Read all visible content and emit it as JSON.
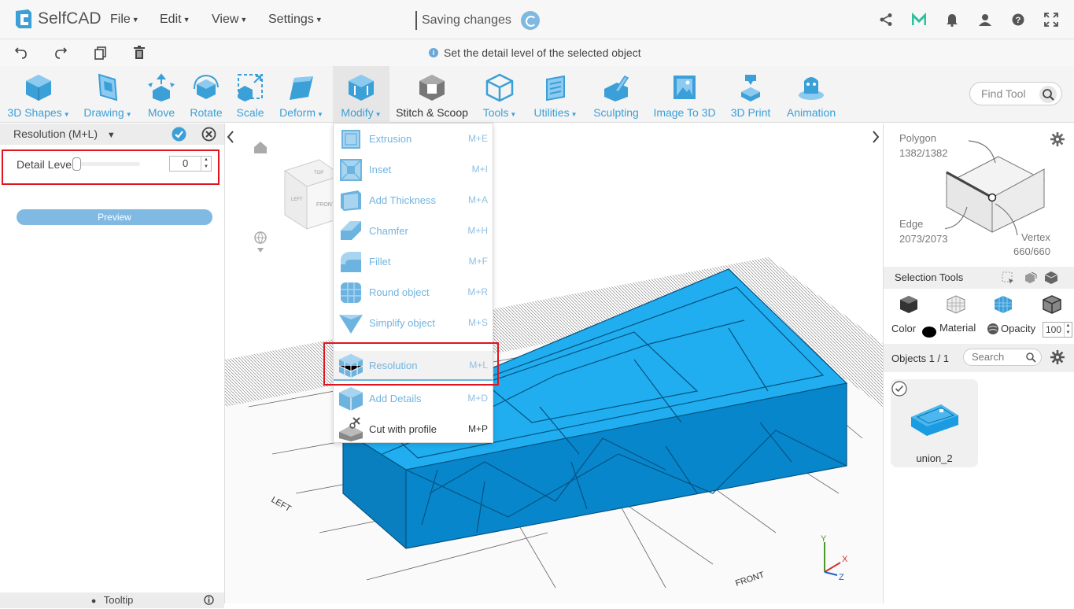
{
  "app": {
    "name": "SelfCAD"
  },
  "menus": [
    {
      "label": "File"
    },
    {
      "label": "Edit"
    },
    {
      "label": "View"
    },
    {
      "label": "Settings"
    }
  ],
  "status": {
    "saving": "Saving changes"
  },
  "hint": {
    "text": "Set the detail level of the selected object"
  },
  "toolbar": {
    "tools": [
      {
        "label": "3D Shapes"
      },
      {
        "label": "Drawing"
      },
      {
        "label": "Move"
      },
      {
        "label": "Rotate"
      },
      {
        "label": "Scale"
      },
      {
        "label": "Deform"
      },
      {
        "label": "Modify"
      },
      {
        "label": "Stitch & Scoop"
      },
      {
        "label": "Tools"
      },
      {
        "label": "Utilities"
      },
      {
        "label": "Sculpting"
      },
      {
        "label": "Image To 3D"
      },
      {
        "label": "3D Print"
      },
      {
        "label": "Animation"
      }
    ],
    "find_placeholder": "Find Tool"
  },
  "left_panel": {
    "title": "Resolution (M+L)",
    "detail_label": "Detail Level",
    "detail_value": "0",
    "detail_level_fraction": 0,
    "preview_label": "Preview",
    "tooltip_label": "Tooltip"
  },
  "modify_menu": {
    "items": [
      {
        "label": "Extrusion",
        "shortcut": "M+E"
      },
      {
        "label": "Inset",
        "shortcut": "M+I"
      },
      {
        "label": "Add Thickness",
        "shortcut": "M+A"
      },
      {
        "label": "Chamfer",
        "shortcut": "M+H"
      },
      {
        "label": "Fillet",
        "shortcut": "M+F"
      },
      {
        "label": "Round object",
        "shortcut": "M+R"
      },
      {
        "label": "Simplify object",
        "shortcut": "M+S"
      },
      {
        "label": "Resolution",
        "shortcut": "M+L"
      },
      {
        "label": "Add Details",
        "shortcut": "M+D"
      },
      {
        "label": "Cut with profile",
        "shortcut": "M+P"
      }
    ]
  },
  "right_panel": {
    "polygon_label": "Polygon",
    "polygon_count": "1382/1382",
    "edge_label": "Edge",
    "edge_count": "2073/2073",
    "vertex_label": "Vertex",
    "vertex_count": "660/660",
    "selection_tools": "Selection Tools",
    "color_label": "Color",
    "material_label": "Material",
    "opacity_label": "Opacity",
    "opacity_value": "100",
    "objects_label": "Objects 1 / 1",
    "search_placeholder": "Search",
    "object_name": "union_2"
  },
  "viewport": {
    "cube_front": "FRONT",
    "cube_top": "TOP",
    "cube_left": "LEFT",
    "floor_left": "LEFT",
    "floor_front": "FRONT",
    "axis_x": "X",
    "axis_y": "Y",
    "axis_z": "Z"
  },
  "colors": {
    "accent": "#3b9fd8",
    "model": "#0a9be6",
    "highlight": "#e0141e"
  }
}
